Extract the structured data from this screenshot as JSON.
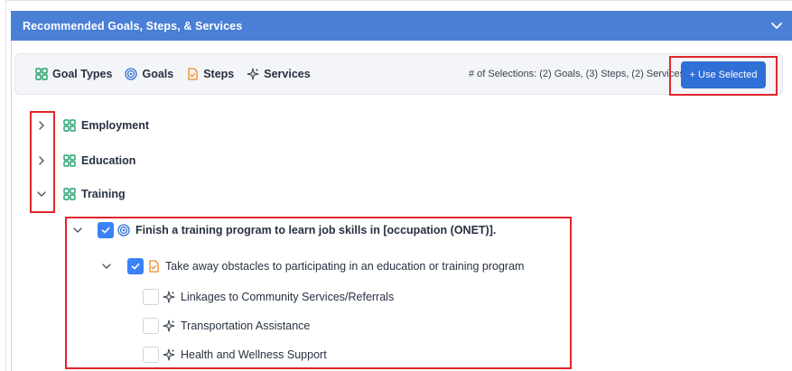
{
  "panel": {
    "title": "Recommended Goals, Steps, & Services"
  },
  "toolbar": {
    "legend": {
      "goal_types": "Goal Types",
      "goals": "Goals",
      "steps": "Steps",
      "services": "Services"
    },
    "selection_count": "# of Selections: (2) Goals, (3) Steps, (2) Services",
    "use_selected_label": "+ Use Selected"
  },
  "tree": {
    "goal_types": [
      {
        "label": "Employment",
        "expanded": false
      },
      {
        "label": "Education",
        "expanded": false
      },
      {
        "label": "Training",
        "expanded": true
      }
    ],
    "goal": {
      "label": "Finish a training program to learn job skills in [occupation (ONET)].",
      "checked": true,
      "expanded": true
    },
    "step": {
      "label": "Take away obstacles to participating in an education or training program",
      "checked": true,
      "expanded": true
    },
    "services": [
      {
        "label": "Linkages to Community Services/Referrals",
        "checked": false
      },
      {
        "label": "Transportation Assistance",
        "checked": false
      },
      {
        "label": "Health and Wellness Support",
        "checked": false
      }
    ]
  },
  "colors": {
    "header_bg": "#4a7fd6",
    "button_bg": "#2f6fd6",
    "goal_type_icon": "#22a06b",
    "goal_icon": "#2f6fd6",
    "step_icon": "#f08a24",
    "highlight": "#e0262a"
  }
}
